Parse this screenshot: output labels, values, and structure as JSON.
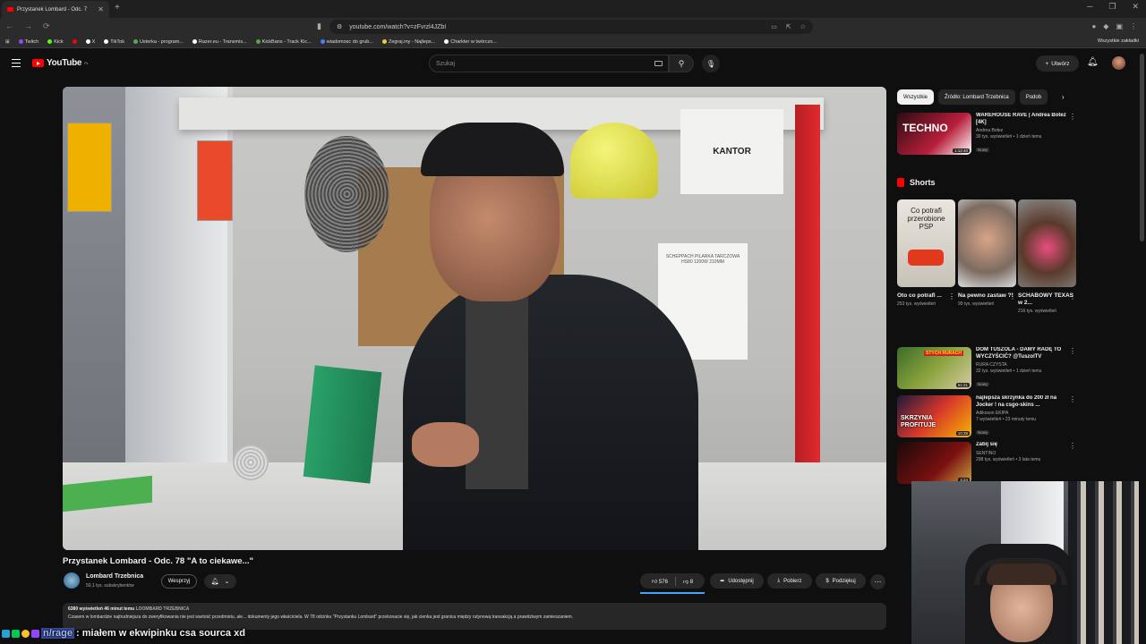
{
  "browser": {
    "tab_title": "Przystanek Lombard - Odc. 7",
    "url": "youtube.com/watch?v=zFvrzl4JZbI",
    "bookmarks": [
      "Twitch",
      "Kick",
      "X",
      "TikTok",
      "Usterka - program...",
      "Razer.eu - Transmis...",
      "KickBans - Track Kic...",
      "wiadomosc do grub...",
      "Zegraj.my - Najleps...",
      "Charkter w twórczo..."
    ],
    "bookmarks_all": "Wszystkie zakładki",
    "bookmark_colors": [
      "#9146ff",
      "#53fc18",
      "#ffffff",
      "#ffffff",
      "#4caf50",
      "#33cc33",
      "#55aa33",
      "#4285f4",
      "#f5c542",
      "#ffffff"
    ]
  },
  "youtube": {
    "logo_text": "YouTube",
    "logo_region": "PL",
    "search_placeholder": "Szukaj",
    "create_label": "Utwórz"
  },
  "video": {
    "title": "Przystanek Lombard - Odc. 78 \"A to ciekawe...\"",
    "channel": "Lombard Trzebnica",
    "subscribers": "50,1 tys. subskrybentów",
    "support_label": "Wesprzyj",
    "likes": "576",
    "dislikes": "8",
    "share_label": "Udostępnij",
    "download_label": "Pobierz",
    "thanks_label": "Podziękuj",
    "desc_views": "6380 wyświetleń  46 minut temu",
    "desc_tag": "LOOMBARD TRZEBNICA",
    "desc_text": "Czasem w lombardzie najtrudniejsza do zweryfikowania nie jest wartość przedmiotu, ale... dokumenty jego właściciela. W 78 odcinku \"Przystanku Lombard\" przekonacie się, jak cienka jest granica między rutynową transakcją a prawdziwym zamieszaniem.",
    "scene_kantor": "KANTOR",
    "scene_paper": "SCHEPPACH PILARKA TARCZOWA HS80 1200W 210MM"
  },
  "chat": {
    "username": "n/rage",
    "message": ": miałem w ekwipinku csa sourca  xd"
  },
  "sidebar": {
    "chips": [
      "Wszystkie",
      "Źródło: Lombard Trzebnica",
      "Podob"
    ],
    "shorts_title": "Shorts",
    "recs_top": [
      {
        "title": "WAREHOUSE RAVE | Andrea Botez [4K]",
        "channel": "Andrea Botez",
        "views": "30 tys. wyświetleń • 1 dzień temu",
        "badge": "Nowy",
        "duration": "1:12:40"
      }
    ],
    "shorts": [
      {
        "title": "Oto co potrafi ...",
        "views": "253 tys. wyświetleń",
        "thumb_text": "Co potrafi przerobione PSP"
      },
      {
        "title": "Na pewno zastaw ?!",
        "views": "99 tys. wyświetleń",
        "thumb_text": ""
      },
      {
        "title": "SCHABOWY TEXAS w 2...",
        "views": "216 tys. wyświetleń",
        "thumb_text": ""
      }
    ],
    "recs": [
      {
        "title": "DOM TUSZOLA - DAMY RADĘ TO WYCZYŚCIĆ? @TuszolTV",
        "channel": "RURA CZYSTA",
        "views": "32 tys. wyświetleń • 1 dzień temu",
        "badge": "Nowy",
        "duration": "51:21",
        "thumb_text": "STYCH RURACH"
      },
      {
        "title": "najlepsza skrzynka do 200 zł na Jocker ! na csgo-skins ...",
        "channel": "Adikoson EKIPA",
        "views": "7 wyświetleń • 23 minuty temu",
        "badge": "Nowy",
        "duration": "10:39",
        "thumb_text": "SKRZYNIA PROFITUJE"
      },
      {
        "title": "Zabij się",
        "channel": "SENTINO",
        "views": "298 tys. wyświetleń • 3 lata temu",
        "badge": "",
        "duration": "4:24",
        "thumb_text": ""
      }
    ]
  }
}
